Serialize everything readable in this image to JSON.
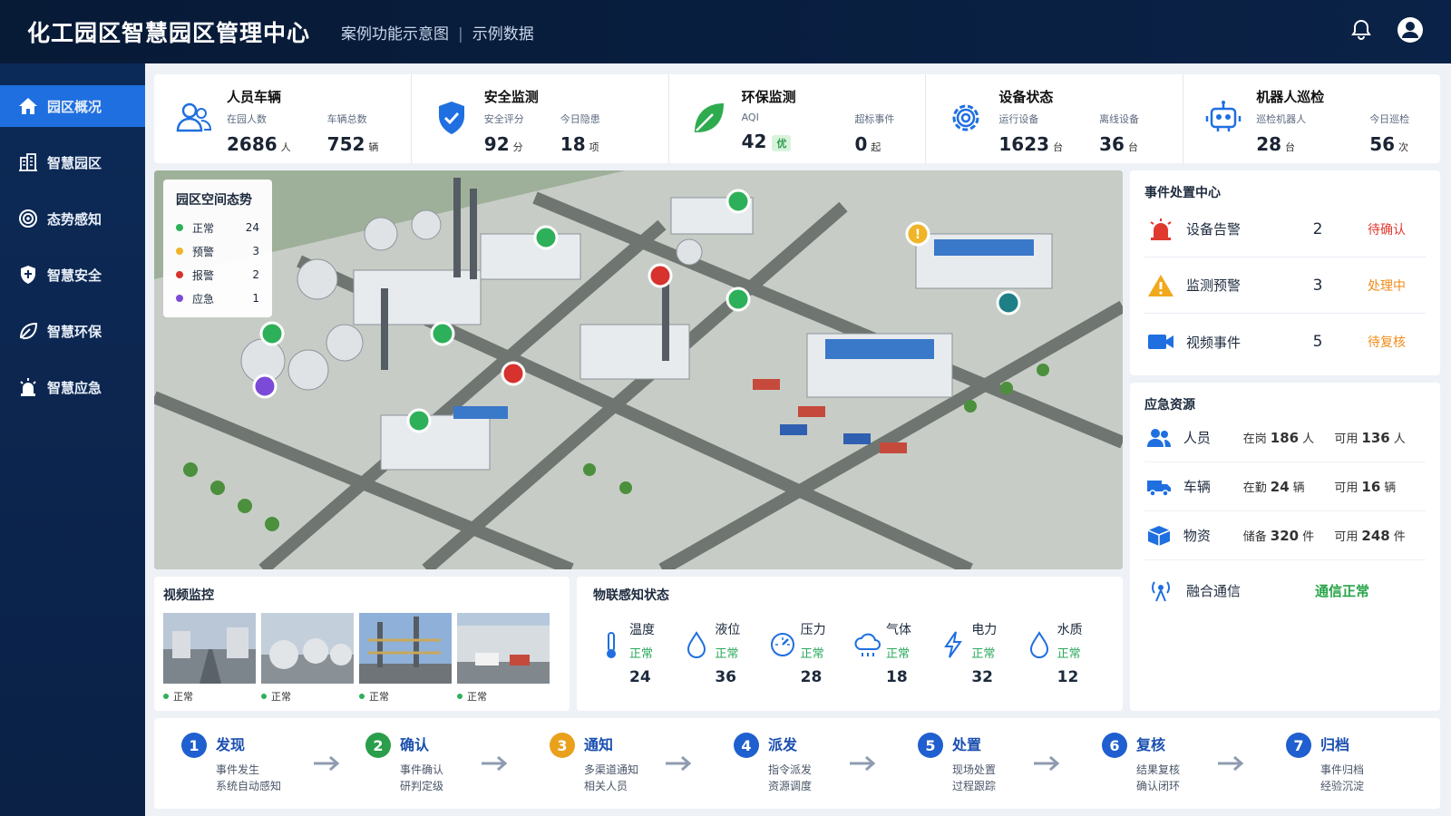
{
  "header": {
    "title": "化工园区智慧园区管理中心",
    "subtitle_a": "案例功能示意图",
    "subtitle_b": "示例数据"
  },
  "sidebar": {
    "items": [
      {
        "label": "园区概况",
        "icon": "home-icon"
      },
      {
        "label": "智慧园区",
        "icon": "building-icon"
      },
      {
        "label": "态势感知",
        "icon": "target-icon"
      },
      {
        "label": "智慧安全",
        "icon": "shield-icon"
      },
      {
        "label": "智慧环保",
        "icon": "leaf-icon"
      },
      {
        "label": "智慧应急",
        "icon": "alarm-icon"
      }
    ]
  },
  "stats": [
    {
      "title": "人员车辆",
      "a_label": "在园人数",
      "a_value": "2686",
      "a_unit": "人",
      "b_label": "车辆总数",
      "b_value": "752",
      "b_unit": "辆"
    },
    {
      "title": "安全监测",
      "a_label": "安全评分",
      "a_value": "92",
      "a_unit": "分",
      "b_label": "今日隐患",
      "b_value": "18",
      "b_unit": "项"
    },
    {
      "title": "环保监测",
      "a_label": "AQI",
      "a_value": "42",
      "a_badge": "优",
      "b_label": "超标事件",
      "b_value": "0",
      "b_unit": "起"
    },
    {
      "title": "设备状态",
      "a_label": "运行设备",
      "a_value": "1623",
      "a_unit": "台",
      "b_label": "离线设备",
      "b_value": "36",
      "b_unit": "台"
    },
    {
      "title": "机器人巡检",
      "a_label": "巡检机器人",
      "a_value": "28",
      "a_unit": "台",
      "b_label": "今日巡检",
      "b_value": "56",
      "b_unit": "次"
    }
  ],
  "map": {
    "legend_title": "园区空间态势",
    "legend": [
      {
        "label": "正常",
        "count": "24",
        "color": "#2eb05a"
      },
      {
        "label": "预警",
        "count": "3",
        "color": "#f0b429"
      },
      {
        "label": "报警",
        "count": "2",
        "color": "#d6322e"
      },
      {
        "label": "应急",
        "count": "1",
        "color": "#7b4ad6"
      }
    ]
  },
  "events": {
    "title": "事件处置中心",
    "items": [
      {
        "name": "设备告警",
        "count": "2",
        "status": "待确认",
        "color": "#e03a2f"
      },
      {
        "name": "监测预警",
        "count": "3",
        "status": "处理中",
        "color": "#f08c1a"
      },
      {
        "name": "视频事件",
        "count": "5",
        "status": "待复核",
        "color": "#f08c1a"
      }
    ]
  },
  "resources": {
    "title": "应急资源",
    "items": [
      {
        "name": "人员",
        "l1": "在岗",
        "v1": "186",
        "u1": "人",
        "l2": "可用",
        "v2": "136",
        "u2": "人"
      },
      {
        "name": "车辆",
        "l1": "在勤",
        "v1": "24",
        "u1": "辆",
        "l2": "可用",
        "v2": "16",
        "u2": "辆"
      },
      {
        "name": "物资",
        "l1": "储备",
        "v1": "320",
        "u1": "件",
        "l2": "可用",
        "v2": "248",
        "u2": "件"
      }
    ],
    "comm_name": "融合通信",
    "comm_status": "通信正常"
  },
  "videos": {
    "title": "视频监控",
    "items": [
      {
        "status": "正常"
      },
      {
        "status": "正常"
      },
      {
        "status": "正常"
      },
      {
        "status": "正常"
      }
    ]
  },
  "iot": {
    "title": "物联感知状态",
    "items": [
      {
        "name": "温度",
        "status": "正常",
        "value": "24"
      },
      {
        "name": "液位",
        "status": "正常",
        "value": "36"
      },
      {
        "name": "压力",
        "status": "正常",
        "value": "28"
      },
      {
        "name": "气体",
        "status": "正常",
        "value": "18"
      },
      {
        "name": "电力",
        "status": "正常",
        "value": "32"
      },
      {
        "name": "水质",
        "status": "正常",
        "value": "12"
      }
    ]
  },
  "flow": [
    {
      "num": "1",
      "title": "发现",
      "d1": "事件发生",
      "d2": "系统自动感知",
      "color": "#1f5fcf"
    },
    {
      "num": "2",
      "title": "确认",
      "d1": "事件确认",
      "d2": "研判定级",
      "color": "#2a9e4a"
    },
    {
      "num": "3",
      "title": "通知",
      "d1": "多渠道通知",
      "d2": "相关人员",
      "color": "#e9a11c"
    },
    {
      "num": "4",
      "title": "派发",
      "d1": "指令派发",
      "d2": "资源调度",
      "color": "#1f5fcf"
    },
    {
      "num": "5",
      "title": "处置",
      "d1": "现场处置",
      "d2": "过程跟踪",
      "color": "#1f5fcf"
    },
    {
      "num": "6",
      "title": "复核",
      "d1": "结果复核",
      "d2": "确认闭环",
      "color": "#1f5fcf"
    },
    {
      "num": "7",
      "title": "归档",
      "d1": "事件归档",
      "d2": "经验沉淀",
      "color": "#1f5fcf"
    }
  ],
  "colors": {
    "primary": "#1f6fe0",
    "sidebar": "#0c2a57",
    "ok": "#2eb05a"
  }
}
